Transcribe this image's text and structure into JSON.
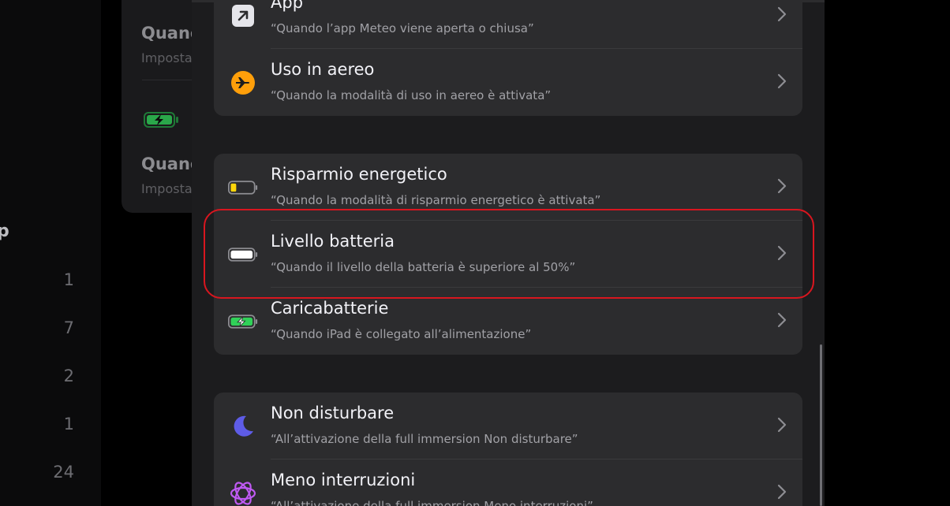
{
  "background": {
    "card_title_1": "Quand",
    "card_sub_1": "Imposta",
    "card_title_2": "Quand",
    "card_sub_2": "Imposta",
    "side_letter": "p",
    "side_numbers": [
      "1",
      "7",
      "2",
      "1",
      "24"
    ]
  },
  "sheet": {
    "groups": [
      {
        "rows": [
          {
            "title": "App",
            "subtitle": "“Quando l’app Meteo viene aperta o chiusa”",
            "icon": "arrow-up-right-icon"
          },
          {
            "title": "Uso in aereo",
            "subtitle": "“Quando la modalità di uso in aereo è attivata”",
            "icon": "airplane-icon"
          }
        ]
      },
      {
        "rows": [
          {
            "title": "Risparmio energetico",
            "subtitle": "“Quando la modalità di risparmio energetico è attivata”",
            "icon": "battery-low-icon"
          },
          {
            "title": "Livello batteria",
            "subtitle": "“Quando il livello della batteria è superiore al 50%”",
            "icon": "battery-full-icon"
          },
          {
            "title": "Caricabatterie",
            "subtitle": "“Quando iPad è collegato all’alimentazione”",
            "icon": "battery-charging-icon"
          }
        ]
      },
      {
        "rows": [
          {
            "title": "Non disturbare",
            "subtitle": "“All’attivazione della full immersion Non disturbare”",
            "icon": "moon-icon"
          },
          {
            "title": "Meno interruzioni",
            "subtitle": "“All’attivazione della full immersion Meno interruzioni”",
            "icon": "reduce-interruptions-icon"
          }
        ]
      }
    ]
  },
  "colors": {
    "highlight": "#d8161f",
    "airplane": "#ff9f0a",
    "low_battery": "#ffd60a",
    "charging": "#30d158",
    "moon": "#5e5ce6",
    "interruptions": "#bf5af2"
  }
}
